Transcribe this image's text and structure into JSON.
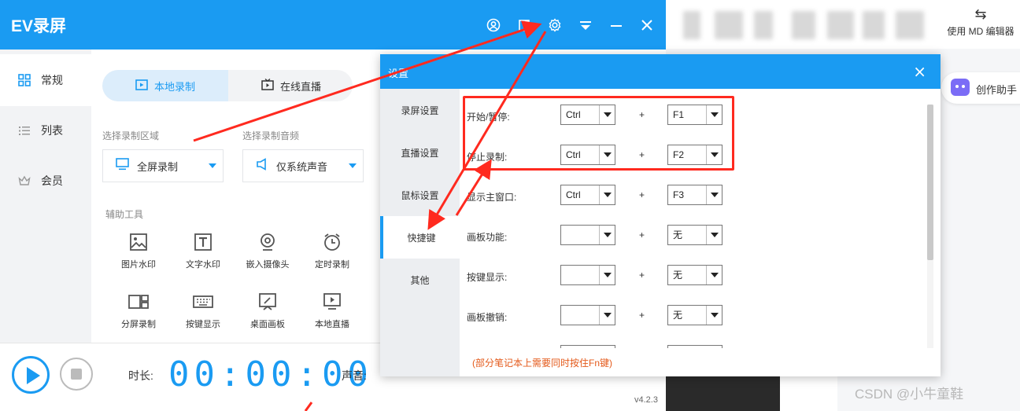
{
  "app": {
    "title": "EV录屏",
    "version": "v4.2.3",
    "titlebar_icons": [
      "user-icon",
      "skin-icon",
      "settings-gear-icon",
      "menu-icon",
      "minimize-icon",
      "close-icon"
    ]
  },
  "sidebar": {
    "items": [
      {
        "label": "常规",
        "icon": "grid-icon",
        "active": true
      },
      {
        "label": "列表",
        "icon": "list-icon",
        "active": false
      },
      {
        "label": "会员",
        "icon": "crown-icon",
        "active": false
      }
    ]
  },
  "mode_tabs": [
    {
      "label": "本地录制",
      "icon": "local-record-icon",
      "active": true
    },
    {
      "label": "在线直播",
      "icon": "live-icon",
      "active": false
    }
  ],
  "record_area": {
    "label": "选择录制区域",
    "value": "全屏录制",
    "icon": "monitor-icon"
  },
  "record_audio": {
    "label": "选择录制音频",
    "value": "仅系统声音",
    "icon": "speaker-icon"
  },
  "tools": {
    "label": "辅助工具",
    "items": [
      {
        "label": "图片水印",
        "icon": "image-icon"
      },
      {
        "label": "文字水印",
        "icon": "text-icon"
      },
      {
        "label": "嵌入摄像头",
        "icon": "camera-icon"
      },
      {
        "label": "定时录制",
        "icon": "alarm-icon"
      },
      {
        "label": "分屏录制",
        "icon": "split-screen-icon"
      },
      {
        "label": "按键显示",
        "icon": "keyboard-icon"
      },
      {
        "label": "桌面画板",
        "icon": "drawing-board-icon"
      },
      {
        "label": "本地直播",
        "icon": "monitor-play-icon"
      }
    ]
  },
  "bottombar": {
    "duration_label": "时长:",
    "duration_value": "00:00:00",
    "sound_label": "声音:"
  },
  "settings_dialog": {
    "title": "设置",
    "close_label": "×",
    "tabs": [
      {
        "label": "录屏设置",
        "active": false
      },
      {
        "label": "直播设置",
        "active": false
      },
      {
        "label": "鼠标设置",
        "active": false
      },
      {
        "label": "快捷键",
        "active": true
      },
      {
        "label": "其他",
        "active": false
      }
    ],
    "plus_label": "+",
    "hotkeys": [
      {
        "label": "开始/暂停:",
        "modifier": "Ctrl",
        "key": "F1"
      },
      {
        "label": "停止录制:",
        "modifier": "Ctrl",
        "key": "F2"
      },
      {
        "label": "显示主窗口:",
        "modifier": "Ctrl",
        "key": "F3"
      },
      {
        "label": "画板功能:",
        "modifier": "",
        "key": "无"
      },
      {
        "label": "按键显示:",
        "modifier": "",
        "key": "无"
      },
      {
        "label": "画板撤销:",
        "modifier": "",
        "key": "无"
      }
    ],
    "note": "(部分笔记本上需要同时按住Fn键)"
  },
  "background_browser": {
    "md_editor_label": "使用 MD 编辑器",
    "assistant_label": "创作助手",
    "watermark": "CSDN @小牛童鞋"
  },
  "annotation_color": "#ff2a1f",
  "accent_color": "#1a9bf2"
}
